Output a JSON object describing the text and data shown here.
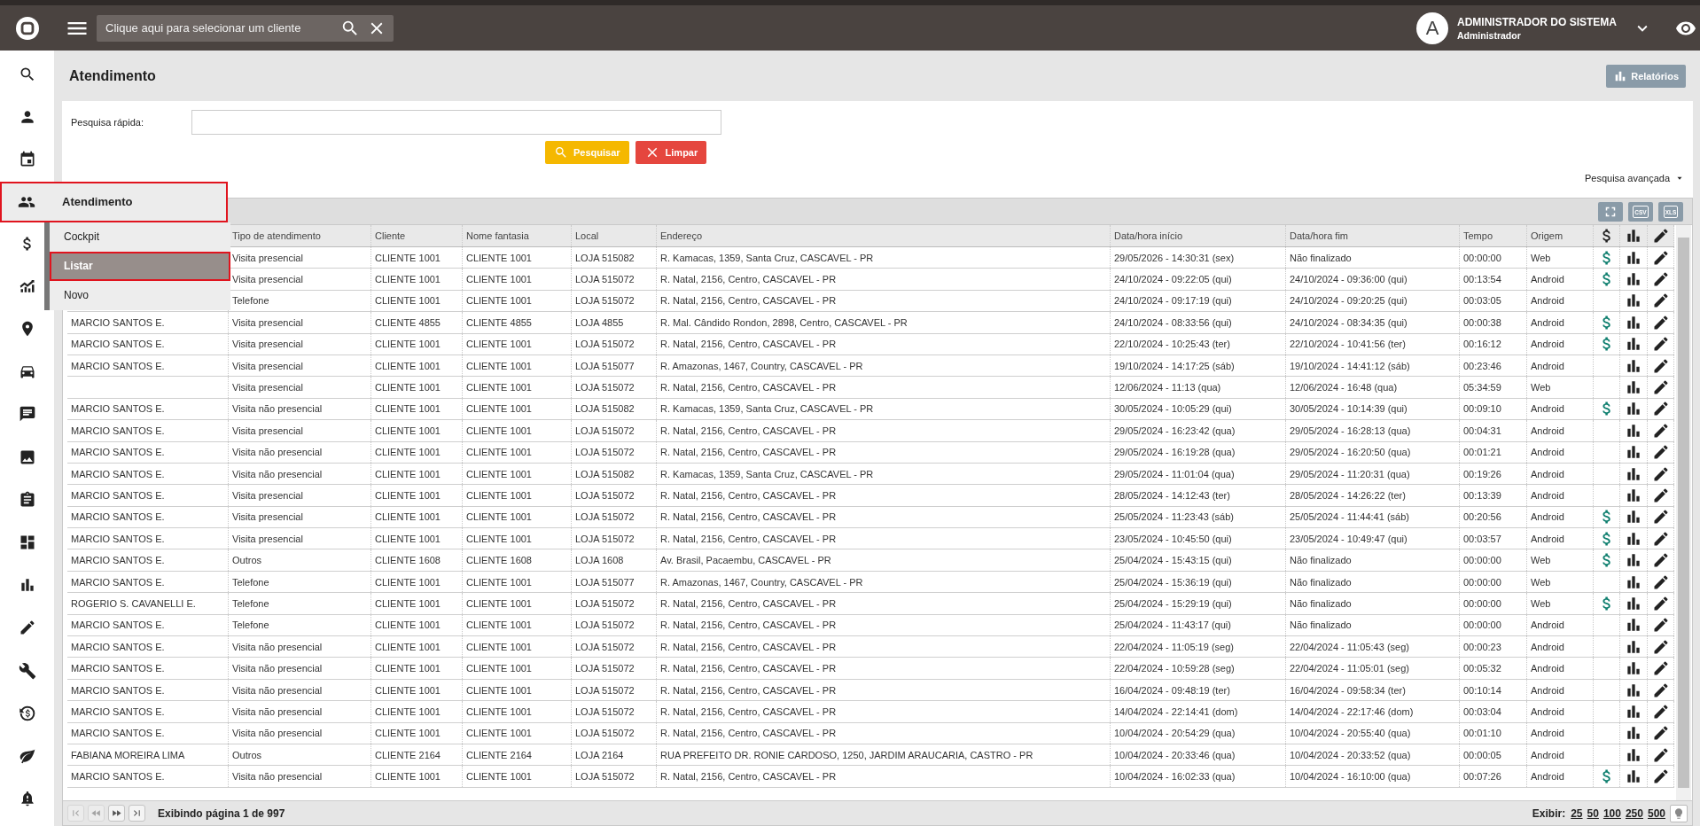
{
  "topbar": {
    "client_search": {
      "placeholder": "Clique aqui para selecionar um cliente"
    },
    "user": {
      "avatar_letter": "A",
      "name": "ADMINISTRADOR DO SISTEMA",
      "role": "Administrador"
    }
  },
  "sidebar": {
    "items": [
      {
        "kind": "search",
        "selected": false
      },
      {
        "kind": "person",
        "selected": false
      },
      {
        "kind": "calendar",
        "selected": false
      },
      {
        "kind": "people",
        "selected": true
      },
      {
        "kind": "dollar",
        "selected": false
      },
      {
        "kind": "trend",
        "selected": false
      },
      {
        "kind": "pin",
        "selected": false
      },
      {
        "kind": "car",
        "selected": false
      },
      {
        "kind": "chat",
        "selected": false
      },
      {
        "kind": "image",
        "selected": false
      },
      {
        "kind": "clipboard",
        "selected": false
      },
      {
        "kind": "dashboard",
        "selected": false
      },
      {
        "kind": "barchart",
        "selected": false
      },
      {
        "kind": "pencil",
        "selected": false
      },
      {
        "kind": "wrench",
        "selected": false
      },
      {
        "kind": "dollarcycle",
        "selected": false
      },
      {
        "kind": "leaf",
        "selected": false
      },
      {
        "kind": "alert",
        "selected": false
      }
    ]
  },
  "flyout": {
    "title": "Atendimento",
    "highlighted": true,
    "items": [
      {
        "label": "Cockpit",
        "selected": false,
        "highlighted": false
      },
      {
        "label": "Listar",
        "selected": true,
        "highlighted": true
      },
      {
        "label": "Novo",
        "selected": false,
        "highlighted": false
      }
    ]
  },
  "page": {
    "title": "Atendimento",
    "reports_button": "Relatórios"
  },
  "quick_search": {
    "label": "Pesquisa rápida:",
    "search_button": "Pesquisar",
    "clear_button": "Limpar",
    "advanced_link": "Pesquisa avançada"
  },
  "grid": {
    "export_buttons": [
      {
        "label": "CSV"
      },
      {
        "label": "XLS"
      }
    ],
    "columns": [
      "Tipo de atendimento",
      "Cliente",
      "Nome fantasia",
      "Local",
      "Endereço",
      "Data/hora início",
      "Data/hora fim",
      "Tempo",
      "Origem"
    ],
    "rows": [
      {
        "cells": [
          "Visita presencial",
          "CLIENTE 1001",
          "CLIENTE 1001",
          "LOJA 515082",
          "R. Kamacas, 1359, Santa Cruz, CASCAVEL - PR",
          "29/05/2026 - 14:30:31 (sex)",
          "Não finalizado",
          "00:00:00",
          "Web"
        ],
        "dollar": true
      },
      {
        "cells": [
          "Visita presencial",
          "CLIENTE 1001",
          "CLIENTE 1001",
          "LOJA 515072",
          "R. Natal, 2156, Centro, CASCAVEL - PR",
          "24/10/2024 - 09:22:05 (qui)",
          "24/10/2024 - 09:36:00 (qui)",
          "00:13:54",
          "Android"
        ],
        "dollar": true
      },
      {
        "cells": [
          "Telefone",
          "CLIENTE 1001",
          "CLIENTE 1001",
          "LOJA 515072",
          "R. Natal, 2156, Centro, CASCAVEL - PR",
          "24/10/2024 - 09:17:19 (qui)",
          "24/10/2024 - 09:20:25 (qui)",
          "00:03:05",
          "Android"
        ],
        "dollar": false
      },
      {
        "column_1": "MARCIO SANTOS E.",
        "cells": [
          "Visita presencial",
          "CLIENTE 4855",
          "CLIENTE 4855",
          "LOJA 4855",
          "R. Mal. Cândido Rondon, 2898, Centro, CASCAVEL - PR",
          "24/10/2024 - 08:33:56 (qui)",
          "24/10/2024 - 08:34:35 (qui)",
          "00:00:38",
          "Android"
        ],
        "dollar": true
      },
      {
        "column_1": "MARCIO SANTOS E.",
        "cells": [
          "Visita presencial",
          "CLIENTE 1001",
          "CLIENTE 1001",
          "LOJA 515072",
          "R. Natal, 2156, Centro, CASCAVEL - PR",
          "22/10/2024 - 10:25:43 (ter)",
          "22/10/2024 - 10:41:56 (ter)",
          "00:16:12",
          "Android"
        ],
        "dollar": true
      },
      {
        "column_1": "MARCIO SANTOS E.",
        "cells": [
          "Visita presencial",
          "CLIENTE 1001",
          "CLIENTE 1001",
          "LOJA 515077",
          "R. Amazonas, 1467, Country, CASCAVEL - PR",
          "19/10/2024 - 14:17:25 (sáb)",
          "19/10/2024 - 14:41:12 (sáb)",
          "00:23:46",
          "Android"
        ],
        "dollar": false
      },
      {
        "cells": [
          "Visita presencial",
          "CLIENTE 1001",
          "CLIENTE 1001",
          "LOJA 515072",
          "R. Natal, 2156, Centro, CASCAVEL - PR",
          "12/06/2024 - 11:13 (qua)",
          "12/06/2024 - 16:48 (qua)",
          "05:34:59",
          "Web"
        ],
        "dollar": false
      },
      {
        "column_1": "MARCIO SANTOS E.",
        "cells": [
          "Visita não presencial",
          "CLIENTE 1001",
          "CLIENTE 1001",
          "LOJA 515082",
          "R. Kamacas, 1359, Santa Cruz, CASCAVEL - PR",
          "30/05/2024 - 10:05:29 (qui)",
          "30/05/2024 - 10:14:39 (qui)",
          "00:09:10",
          "Android"
        ],
        "dollar": true
      },
      {
        "column_1": "MARCIO SANTOS E.",
        "cells": [
          "Visita presencial",
          "CLIENTE 1001",
          "CLIENTE 1001",
          "LOJA 515072",
          "R. Natal, 2156, Centro, CASCAVEL - PR",
          "29/05/2024 - 16:23:42 (qua)",
          "29/05/2024 - 16:28:13 (qua)",
          "00:04:31",
          "Android"
        ],
        "dollar": false
      },
      {
        "column_1": "MARCIO SANTOS E.",
        "cells": [
          "Visita não presencial",
          "CLIENTE 1001",
          "CLIENTE 1001",
          "LOJA 515072",
          "R. Natal, 2156, Centro, CASCAVEL - PR",
          "29/05/2024 - 16:19:28 (qua)",
          "29/05/2024 - 16:20:50 (qua)",
          "00:01:21",
          "Android"
        ],
        "dollar": false
      },
      {
        "column_1": "MARCIO SANTOS E.",
        "cells": [
          "Visita não presencial",
          "CLIENTE 1001",
          "CLIENTE 1001",
          "LOJA 515082",
          "R. Kamacas, 1359, Santa Cruz, CASCAVEL - PR",
          "29/05/2024 - 11:01:04 (qua)",
          "29/05/2024 - 11:20:31 (qua)",
          "00:19:26",
          "Android"
        ],
        "dollar": false
      },
      {
        "column_1": "MARCIO SANTOS E.",
        "cells": [
          "Visita presencial",
          "CLIENTE 1001",
          "CLIENTE 1001",
          "LOJA 515072",
          "R. Natal, 2156, Centro, CASCAVEL - PR",
          "28/05/2024 - 14:12:43 (ter)",
          "28/05/2024 - 14:26:22 (ter)",
          "00:13:39",
          "Android"
        ],
        "dollar": false
      },
      {
        "column_1": "MARCIO SANTOS E.",
        "cells": [
          "Visita presencial",
          "CLIENTE 1001",
          "CLIENTE 1001",
          "LOJA 515072",
          "R. Natal, 2156, Centro, CASCAVEL - PR",
          "25/05/2024 - 11:23:43 (sáb)",
          "25/05/2024 - 11:44:41 (sáb)",
          "00:20:56",
          "Android"
        ],
        "dollar": true
      },
      {
        "column_1": "MARCIO SANTOS E.",
        "cells": [
          "Visita presencial",
          "CLIENTE 1001",
          "CLIENTE 1001",
          "LOJA 515072",
          "R. Natal, 2156, Centro, CASCAVEL - PR",
          "23/05/2024 - 10:45:50 (qui)",
          "23/05/2024 - 10:49:47 (qui)",
          "00:03:57",
          "Android"
        ],
        "dollar": true
      },
      {
        "column_1": "MARCIO SANTOS E.",
        "cells": [
          "Outros",
          "CLIENTE 1608",
          "CLIENTE 1608",
          "LOJA 1608",
          "Av. Brasil, Pacaembu, CASCAVEL - PR",
          "25/04/2024 - 15:43:15 (qui)",
          "Não finalizado",
          "00:00:00",
          "Web"
        ],
        "dollar": true
      },
      {
        "column_1": "MARCIO SANTOS E.",
        "cells": [
          "Telefone",
          "CLIENTE 1001",
          "CLIENTE 1001",
          "LOJA 515077",
          "R. Amazonas, 1467, Country, CASCAVEL - PR",
          "25/04/2024 - 15:36:19 (qui)",
          "Não finalizado",
          "00:00:00",
          "Web"
        ],
        "dollar": false
      },
      {
        "column_1": "ROGERIO S. CAVANELLI E.",
        "cells": [
          "Telefone",
          "CLIENTE 1001",
          "CLIENTE 1001",
          "LOJA 515072",
          "R. Natal, 2156, Centro, CASCAVEL - PR",
          "25/04/2024 - 15:29:19 (qui)",
          "Não finalizado",
          "00:00:00",
          "Web"
        ],
        "dollar": true
      },
      {
        "column_1": "MARCIO SANTOS E.",
        "cells": [
          "Telefone",
          "CLIENTE 1001",
          "CLIENTE 1001",
          "LOJA 515072",
          "R. Natal, 2156, Centro, CASCAVEL - PR",
          "25/04/2024 - 11:43:17 (qui)",
          "Não finalizado",
          "00:00:00",
          "Android"
        ],
        "dollar": false
      },
      {
        "column_1": "MARCIO SANTOS E.",
        "cells": [
          "Visita não presencial",
          "CLIENTE 1001",
          "CLIENTE 1001",
          "LOJA 515072",
          "R. Natal, 2156, Centro, CASCAVEL - PR",
          "22/04/2024 - 11:05:19 (seg)",
          "22/04/2024 - 11:05:43 (seg)",
          "00:00:23",
          "Android"
        ],
        "dollar": false
      },
      {
        "column_1": "MARCIO SANTOS E.",
        "cells": [
          "Visita não presencial",
          "CLIENTE 1001",
          "CLIENTE 1001",
          "LOJA 515072",
          "R. Natal, 2156, Centro, CASCAVEL - PR",
          "22/04/2024 - 10:59:28 (seg)",
          "22/04/2024 - 11:05:01 (seg)",
          "00:05:32",
          "Android"
        ],
        "dollar": false
      },
      {
        "column_1": "MARCIO SANTOS E.",
        "cells": [
          "Visita não presencial",
          "CLIENTE 1001",
          "CLIENTE 1001",
          "LOJA 515072",
          "R. Natal, 2156, Centro, CASCAVEL - PR",
          "16/04/2024 - 09:48:19 (ter)",
          "16/04/2024 - 09:58:34 (ter)",
          "00:10:14",
          "Android"
        ],
        "dollar": false
      },
      {
        "column_1": "MARCIO SANTOS E.",
        "cells": [
          "Visita não presencial",
          "CLIENTE 1001",
          "CLIENTE 1001",
          "LOJA 515072",
          "R. Natal, 2156, Centro, CASCAVEL - PR",
          "14/04/2024 - 22:14:41 (dom)",
          "14/04/2024 - 22:17:46 (dom)",
          "00:03:04",
          "Android"
        ],
        "dollar": false
      },
      {
        "column_1": "MARCIO SANTOS E.",
        "cells": [
          "Visita não presencial",
          "CLIENTE 1001",
          "CLIENTE 1001",
          "LOJA 515072",
          "R. Natal, 2156, Centro, CASCAVEL - PR",
          "10/04/2024 - 20:54:29 (qua)",
          "10/04/2024 - 20:55:40 (qua)",
          "00:01:10",
          "Android"
        ],
        "dollar": false
      },
      {
        "column_1": "FABIANA MOREIRA LIMA",
        "cells": [
          "Outros",
          "CLIENTE 2164",
          "CLIENTE 2164",
          "LOJA 2164",
          "RUA PREFEITO DR. RONIE CARDOSO, 1250, JARDIM ARAUCARIA, CASTRO - PR",
          "10/04/2024 - 20:33:46 (qua)",
          "10/04/2024 - 20:33:52 (qua)",
          "00:00:05",
          "Android"
        ],
        "dollar": false
      },
      {
        "column_1": "MARCIO SANTOS E.",
        "cells": [
          "Visita não presencial",
          "CLIENTE 1001",
          "CLIENTE 1001",
          "LOJA 515072",
          "R. Natal, 2156, Centro, CASCAVEL - PR",
          "10/04/2024 - 16:02:33 (qua)",
          "10/04/2024 - 16:10:00 (qua)",
          "00:07:26",
          "Android"
        ],
        "dollar": true
      }
    ]
  },
  "footer": {
    "pager": [
      {
        "kind": "first",
        "disabled": true
      },
      {
        "kind": "prev",
        "disabled": true
      },
      {
        "kind": "next",
        "disabled": false
      },
      {
        "kind": "last",
        "disabled": false
      }
    ],
    "page_info": "Exibindo página 1 de 997",
    "show_label": "Exibir:",
    "page_sizes": [
      "25",
      "50",
      "100",
      "250",
      "500"
    ]
  }
}
